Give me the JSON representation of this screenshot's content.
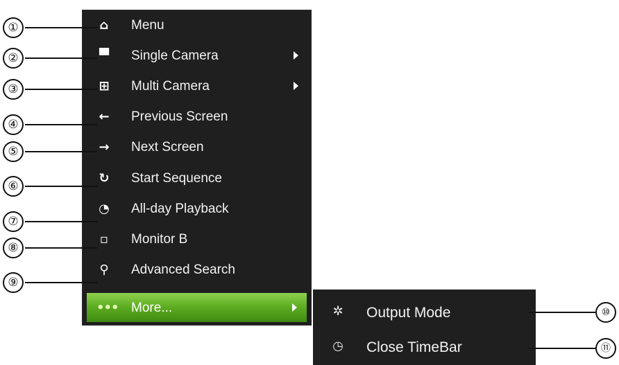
{
  "menu": {
    "items": [
      {
        "label": "Menu",
        "icon": "home-icon",
        "glyph": "⌂",
        "submenu": false
      },
      {
        "label": "Single Camera",
        "icon": "camera-icon",
        "glyph": "▀",
        "submenu": true
      },
      {
        "label": "Multi Camera",
        "icon": "multi-camera-icon",
        "glyph": "⊞",
        "submenu": true
      },
      {
        "label": "Previous Screen",
        "icon": "arrow-left-icon",
        "glyph": "←",
        "submenu": false
      },
      {
        "label": "Next Screen",
        "icon": "arrow-right-icon",
        "glyph": "→",
        "submenu": false
      },
      {
        "label": "Start Sequence",
        "icon": "refresh-icon",
        "glyph": "↻",
        "submenu": false
      },
      {
        "label": "All-day Playback",
        "icon": "playback-icon",
        "glyph": "◔",
        "submenu": false
      },
      {
        "label": "Monitor B",
        "icon": "monitor-icon",
        "glyph": "▫",
        "submenu": false
      },
      {
        "label": "Advanced Search",
        "icon": "search-icon",
        "glyph": "⚲",
        "submenu": false
      },
      {
        "label": "More...",
        "icon": "more-icon",
        "glyph": "•••",
        "submenu": true,
        "active": true
      }
    ]
  },
  "submenu": {
    "items": [
      {
        "label": "Output Mode",
        "icon": "output-mode-icon",
        "glyph": "✲"
      },
      {
        "label": "Close TimeBar",
        "icon": "clock-icon",
        "glyph": "◷"
      }
    ]
  },
  "callouts": [
    "①",
    "②",
    "③",
    "④",
    "⑤",
    "⑥",
    "⑦",
    "⑧",
    "⑨",
    "⑩",
    "⑪"
  ],
  "colors": {
    "menu_background": "#1f1f1f",
    "active_green": "#5fae23",
    "text": "#f2f2f2"
  }
}
